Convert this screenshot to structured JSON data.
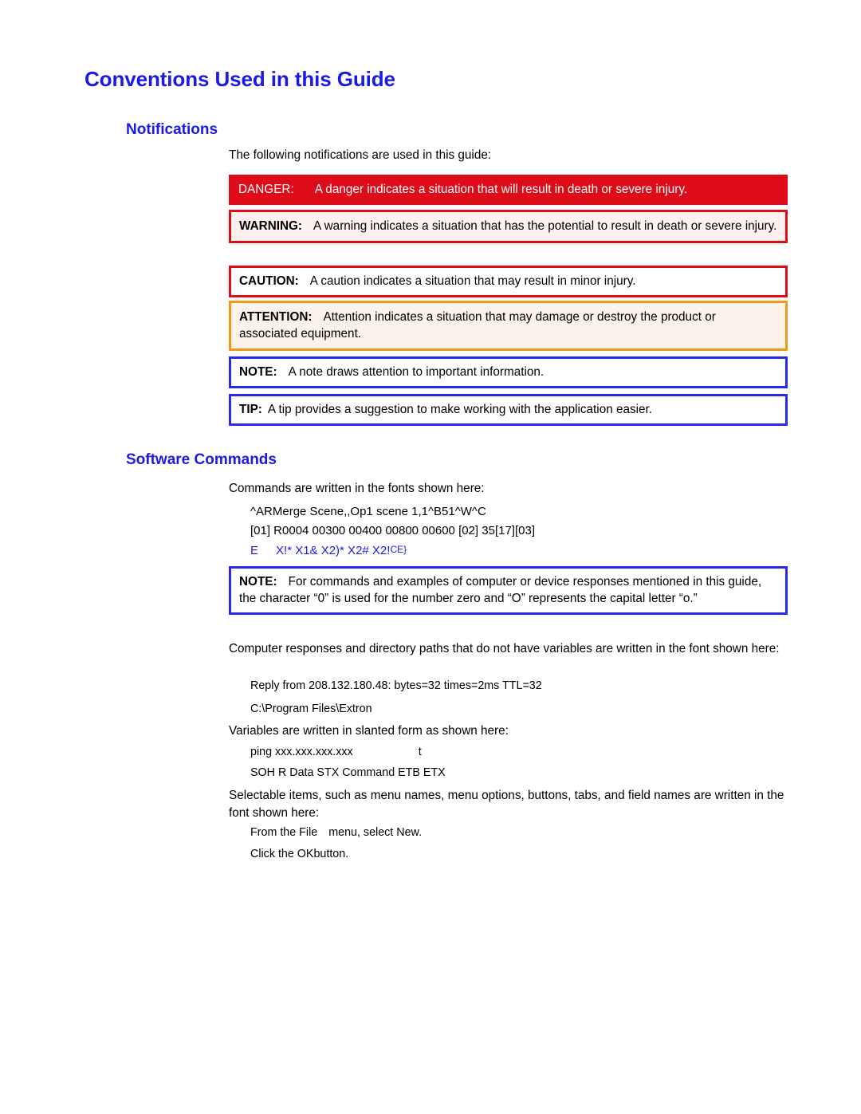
{
  "document": {
    "page_title": "Conventions Used in this Guide",
    "heading_color": "#1a1ae8"
  },
  "sections": {
    "notifications": {
      "heading": "Notifications",
      "intro": "The following notifications are used in this guide:",
      "notices": [
        {
          "id": "danger",
          "label": "DANGER:",
          "text": "A danger indicates a situation that will result in death or severe injury.",
          "border_color": "#de0c18",
          "background_color": "#de0c18",
          "text_color": "#ffffff"
        },
        {
          "id": "warning",
          "label": "WARNING:",
          "text": "A warning indicates a situation that has the potential to result in death or severe injury.",
          "border_color": "#e00d18",
          "background_color": "#fdf0ef",
          "text_color": "#000000"
        },
        {
          "id": "caution",
          "label": "CAUTION:",
          "text": "A caution indicates a situation that may result in minor injury.",
          "border_color": "#e00d18",
          "background_color": "#ffffff",
          "text_color": "#000000"
        },
        {
          "id": "attention",
          "label": "ATTENTION:",
          "text": "Attention indicates a situation that may damage or destroy the product or associated equipment.",
          "border_color": "#ee9b18",
          "background_color": "#fdf2ea",
          "text_color": "#000000"
        },
        {
          "id": "note",
          "label": "NOTE:",
          "text": "A note draws attention to important information.",
          "border_color": "#2a2aee",
          "background_color": "#ffffff",
          "text_color": "#000000"
        },
        {
          "id": "tip",
          "label": "TIP:",
          "text": "A tip provides a suggestion to make working with the application easier.",
          "border_color": "#2a2aee",
          "background_color": "#ffffff",
          "text_color": "#000000"
        }
      ]
    },
    "software_commands": {
      "heading": "Software Commands",
      "intro": "Commands are written in the fonts shown here:",
      "command_examples": [
        "^ARMerge Scene,,Op1 scene 1,1^B51^W^C",
        "[01] R0004 00300 00400 00800 00600 [02] 35[17][03]",
        "E X!* X1& X2)* X2# X2!CE}"
      ],
      "command_example_blue": {
        "prefix": "E",
        "body": "X!* X1& X2)* X2# X2!",
        "suffix": "CE}",
        "color": "#1a1ae8"
      },
      "zero_note": {
        "label": "NOTE:",
        "text": "For commands and examples of computer or device responses mentioned in this guide, the character “0” is used for the number zero and “O” represents the capital letter “o.”",
        "border_color": "#2a2aee",
        "background_color": "#ffffff"
      },
      "computer_responses": {
        "intro": "Computer responses and directory paths that do not have variables are written in the font shown here:",
        "examples": [
          "Reply from 208.132.180.48: bytes=32 times=2ms TTL=32",
          "C:\\Program Files\\Extron"
        ]
      },
      "variables": {
        "intro": "Variables are written in slanted form as shown here:",
        "examples": [
          "ping xxx.xxx.xxx.xxx",
          "SOH R Data STX Command ETB ETX"
        ],
        "trailing_glyph": "t"
      },
      "selectable_items": {
        "intro": "Selectable items, such as menu names, menu options, buttons, tabs, and field names are written in the font shown here:",
        "examples": [
          {
            "prefix": "From the File",
            "middle": "menu, select New",
            "suffix": "."
          },
          {
            "prefix": "Click the OK",
            "middle": "button.",
            "suffix": ""
          }
        ]
      }
    }
  }
}
